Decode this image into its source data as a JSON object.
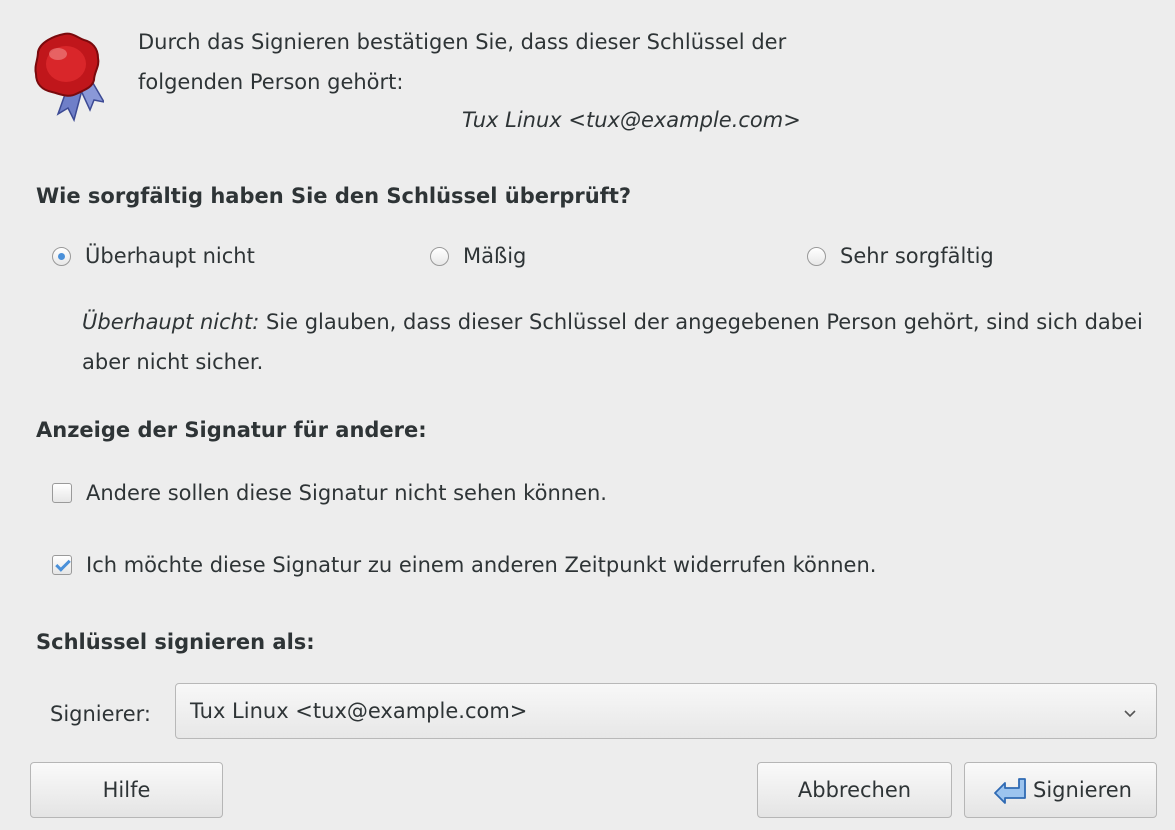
{
  "header": {
    "intro_text": "Durch das Signieren bestätigen Sie, dass dieser Schlüssel der folgenden Person gehört:",
    "person": "Tux Linux <tux@example.com>",
    "icon": "seal-icon"
  },
  "verification": {
    "heading": "Wie sorgfältig haben Sie den Schlüssel überprüft?",
    "options": [
      {
        "label": "Überhaupt nicht",
        "checked": true
      },
      {
        "label": "Mäßig",
        "checked": false
      },
      {
        "label": "Sehr sorgfältig",
        "checked": false
      }
    ],
    "description_label": "Überhaupt nicht:",
    "description_text": " Sie glauben, dass dieser Schlüssel der angegebenen Person gehört, sind sich dabei aber nicht sicher."
  },
  "display": {
    "heading": "Anzeige der Signatur für andere:",
    "checkboxes": [
      {
        "label": "Andere sollen diese Signatur nicht sehen können.",
        "checked": false
      },
      {
        "label": "Ich möchte diese Signatur zu einem anderen Zeitpunkt widerrufen können.",
        "checked": true
      }
    ]
  },
  "signing": {
    "heading": "Schlüssel signieren als:",
    "signer_label": "Signierer:",
    "signer_value": "Tux Linux <tux@example.com>"
  },
  "buttons": {
    "help": "Hilfe",
    "cancel": "Abbrechen",
    "sign": "Signieren"
  },
  "colors": {
    "accent": "#4a90d9",
    "background": "#ededed",
    "seal": "#c0161b"
  }
}
